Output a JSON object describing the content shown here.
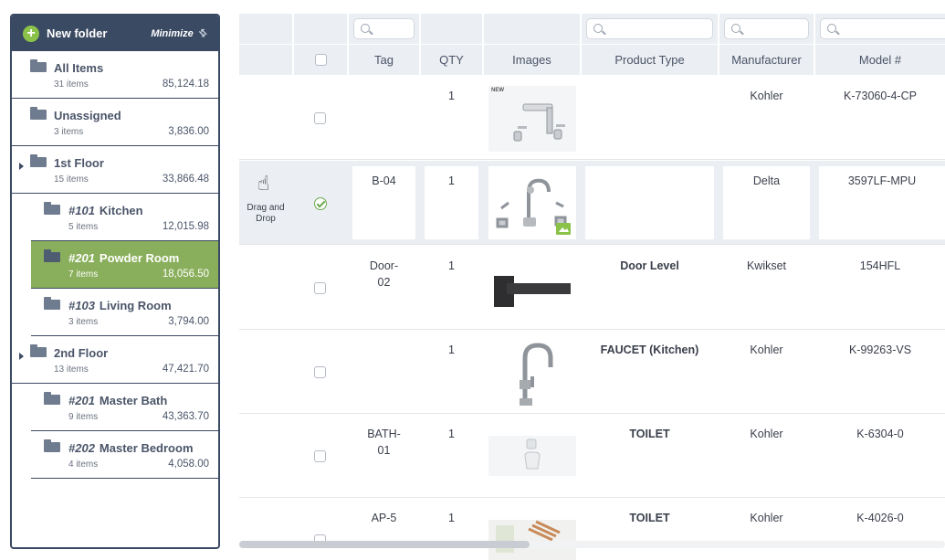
{
  "sidebar": {
    "new_folder_label": "New folder",
    "minimize_label": "Minimize",
    "folders": [
      {
        "name": "All Items",
        "num": "",
        "count": "31 items",
        "total": "85,124.18"
      },
      {
        "name": "Unassigned",
        "num": "",
        "count": "3 items",
        "total": "3,836.00"
      },
      {
        "name": "1st Floor",
        "num": "",
        "count": "15 items",
        "total": "33,866.48"
      },
      {
        "name": "Kitchen",
        "num": "#101",
        "count": "5 items",
        "total": "12,015.98"
      },
      {
        "name": "Powder Room",
        "num": "#201",
        "count": "7 items",
        "total": "18,056.50"
      },
      {
        "name": "Living Room",
        "num": "#103",
        "count": "3 items",
        "total": "3,794.00"
      },
      {
        "name": "2nd Floor",
        "num": "",
        "count": "13 items",
        "total": "47,421.70"
      },
      {
        "name": "Master Bath",
        "num": "#201",
        "count": "9 items",
        "total": "43,363.70"
      },
      {
        "name": "Master Bedroom",
        "num": "#202",
        "count": "4 items",
        "total": "4,058.00"
      }
    ]
  },
  "table": {
    "columns": [
      "Tag",
      "QTY",
      "Images",
      "Product Type",
      "Manufacturer",
      "Model #"
    ],
    "drag_hint": "Drag and Drop",
    "rows": [
      {
        "tag": "",
        "qty": "1",
        "image_badge": "NEW",
        "product_type": "",
        "manufacturer": "Kohler",
        "model": "K-73060-4-CP",
        "checked": false
      },
      {
        "tag": "B-04",
        "qty": "1",
        "image_badge": "",
        "product_type": "",
        "manufacturer": "Delta",
        "model": "3597LF-MPU",
        "checked": true
      },
      {
        "tag": "Door-\n02",
        "qty": "1",
        "image_badge": "",
        "product_type": "Door Level",
        "manufacturer": "Kwikset",
        "model": "154HFL",
        "checked": false
      },
      {
        "tag": "",
        "qty": "1",
        "image_badge": "",
        "product_type": "FAUCET (Kitchen)",
        "manufacturer": "Kohler",
        "model": "K-99263-VS",
        "checked": false
      },
      {
        "tag": "BATH-\n01",
        "qty": "1",
        "image_badge": "",
        "product_type": "TOILET",
        "manufacturer": "Kohler",
        "model": "K-6304-0",
        "checked": false
      },
      {
        "tag": "AP-5",
        "qty": "1",
        "image_badge": "",
        "product_type": "TOILET",
        "manufacturer": "Kohler",
        "model": "K-4026-0",
        "checked": false
      }
    ]
  },
  "colors": {
    "sidebar_header": "#3b4a63",
    "selected_folder": "#8aaf5c",
    "accent_green": "#8bc34a",
    "header_bg": "#ebeef2"
  }
}
